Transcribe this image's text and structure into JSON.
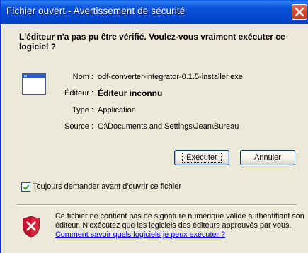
{
  "window": {
    "title": "Fichier ouvert - Avertissement de sécurité"
  },
  "heading": "L'éditeur n'a pas pu être vérifié. Voulez-vous vraiment exécuter ce logiciel ?",
  "details": {
    "name_label": "Nom :",
    "name_value": "odf-converter-integrator-0.1.5-installer.exe",
    "publisher_label": "Éditeur :",
    "publisher_value": "Éditeur inconnu",
    "type_label": "Type :",
    "type_value": "Application",
    "source_label": "Source :",
    "source_value": "C:\\Documents and Settings\\Jean\\Bureau"
  },
  "buttons": {
    "run_label": "Exécuter",
    "cancel_label": "Annuler"
  },
  "checkbox": {
    "label": "Toujours demander avant d'ouvrir ce fichier",
    "checked": true
  },
  "warning": {
    "text": "Ce fichier ne contient pas de signature numérique valide authentifiant son éditeur. N'exécutez que les logiciels des éditeurs approuvés par vous. ",
    "link_text": "Comment savoir quels logiciels je peux exécuter ?"
  },
  "icons": {
    "close": "close-icon",
    "file": "application-file-icon",
    "shield": "security-shield-icon",
    "check": "checkmark-icon"
  },
  "colors": {
    "titlebar": "#0547D0",
    "window_bg": "#ECE9D8",
    "close_button": "#D8442A",
    "link": "#0000FF",
    "shield_red": "#C8102E"
  }
}
